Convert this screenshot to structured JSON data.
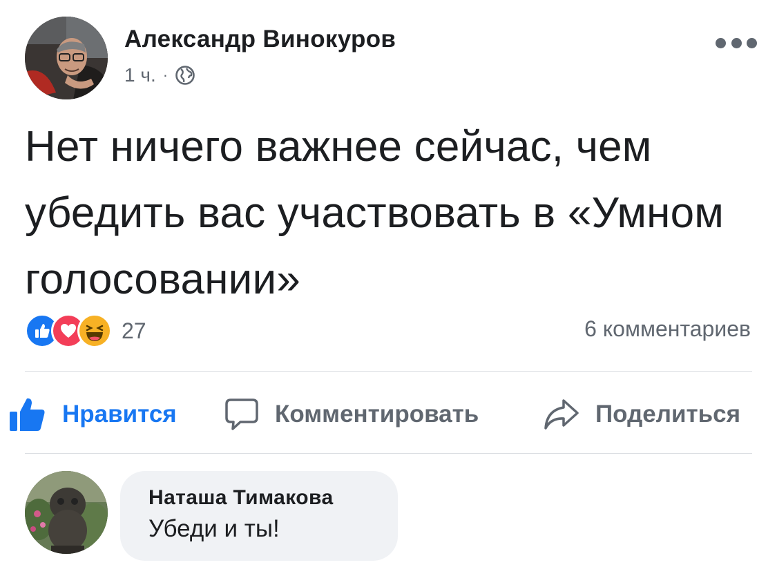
{
  "post": {
    "author": "Александр Винокуров",
    "time": "1 ч.",
    "separator": "·",
    "privacy_icon": "globe-icon",
    "text": "Нет ничего важнее сейчас, чем убедить вас участвовать в «Умном голосовании»"
  },
  "reactions": {
    "icons": [
      "like-reaction-icon",
      "love-reaction-icon",
      "haha-reaction-icon"
    ],
    "count": "27",
    "comments_label": "6 комментариев"
  },
  "actions": {
    "like": "Нравится",
    "comment": "Комментировать",
    "share": "Поделиться"
  },
  "comment": {
    "author": "Наташа Тимакова",
    "text": "Убеди и ты!"
  },
  "colors": {
    "accent": "#1877f2",
    "like_blue": "#1877f2",
    "love_red": "#f33e58",
    "haha_yellow": "#f7b125",
    "secondary_text": "#606770",
    "bubble_bg": "#f0f2f5"
  }
}
